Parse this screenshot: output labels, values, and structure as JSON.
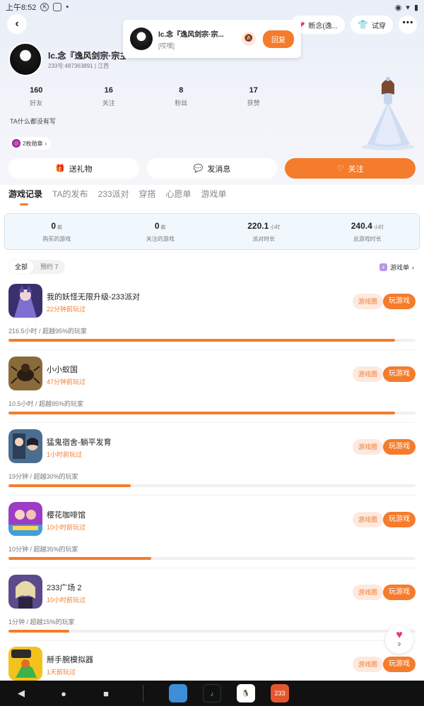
{
  "status_bar": {
    "time": "上午8:52"
  },
  "header": {
    "back_icon": "back-arrow-icon",
    "pills": {
      "like_label": "断念(逸...",
      "tryon_label": "试穿"
    }
  },
  "notification": {
    "title": "lc.念『逸风剑宗·宗...",
    "message": "[哎嘿]",
    "reply_label": "回复"
  },
  "profile": {
    "name": "lc.念『逸风剑宗·宗主夫",
    "id_line": "233号:487363891 | 江西",
    "bio": "TA什么都没有写",
    "badge_label": "2枚勋章",
    "stats": [
      {
        "num": "160",
        "label": "好友"
      },
      {
        "num": "16",
        "label": "关注"
      },
      {
        "num": "8",
        "label": "粉丝"
      },
      {
        "num": "17",
        "label": "获赞"
      }
    ]
  },
  "actions": {
    "gift": "送礼物",
    "message": "发消息",
    "follow": "关注"
  },
  "tabs": [
    "游戏记录",
    "TA的发布",
    "233派对",
    "穿搭",
    "心愿单",
    "游戏单"
  ],
  "summary": [
    {
      "num": "0",
      "unit": "款",
      "label": "购买的游戏"
    },
    {
      "num": "0",
      "unit": "款",
      "label": "关注的游戏"
    },
    {
      "num": "220.1",
      "unit": "小时",
      "label": "派对时长"
    },
    {
      "num": "240.4",
      "unit": "小时",
      "label": "总游戏时长"
    }
  ],
  "filters": {
    "all": "全部",
    "reserved": "预约 7"
  },
  "gamelist_link": "游戏单",
  "game_buttons": {
    "circle": "游戏圈",
    "play": "玩游戏"
  },
  "games": [
    {
      "name": "我的妖怪无限升级-233派对",
      "last_played": "22分钟前玩过",
      "stat": "216.5小时 / 超越95%的玩家",
      "progress": 0.95
    },
    {
      "name": "小小蚁国",
      "last_played": "47分钟前玩过",
      "stat": "10.5小时 / 超越95%的玩家",
      "progress": 0.95
    },
    {
      "name": "猛鬼宿舍-躺平发育",
      "last_played": "1小时前玩过",
      "stat": "19分钟 / 超越30%的玩家",
      "progress": 0.3
    },
    {
      "name": "樱花咖啡馆",
      "last_played": "10小时前玩过",
      "stat": "10分钟 / 超越35%的玩家",
      "progress": 0.35
    },
    {
      "name": "233广场 2",
      "last_played": "10小时前玩过",
      "stat": "1分钟 / 超越15%的玩家",
      "progress": 0.15
    },
    {
      "name": "掰手腕模拟器",
      "last_played": "1天前玩过",
      "stat": "",
      "progress": 0
    }
  ],
  "like_float": {
    "count": "9"
  },
  "dock": {
    "app_233": "233"
  },
  "colors": {
    "accent": "#f47c2c",
    "accent_light": "#fde9df"
  }
}
